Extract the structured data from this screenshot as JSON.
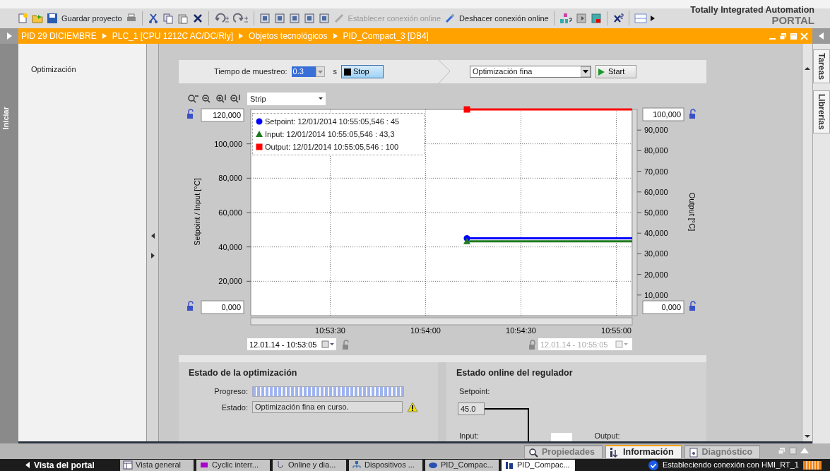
{
  "toolbar": {
    "save_label": "Guardar proyecto",
    "connect_label": "Establecer conexión online",
    "connect_disabled": true,
    "disconnect_label": "Deshacer conexión online"
  },
  "brand": {
    "line1": "Totally Integrated Automation",
    "line2": "PORTAL"
  },
  "breadcrumb": [
    "PID 29 DICIEMBRE",
    "PLC_1 [CPU 1212C AC/DC/Rly]",
    "Objetos tecnológicos",
    "PID_Compact_3 [DB4]"
  ],
  "left_side_tab": "Iniciar",
  "right_side_tabs": [
    "Tareas",
    "Librerías"
  ],
  "navigation": {
    "items": [
      "Optimización"
    ]
  },
  "measurement": {
    "sample_time_label": "Tiempo de muestreo:",
    "sample_time": "0.3",
    "unit": "s",
    "stop_button": "Stop"
  },
  "tuning": {
    "mode": "Optimización fina",
    "start_button": "Start"
  },
  "trend": {
    "view_mode": "Strip",
    "left_max": "120,000",
    "left_min": "0,000",
    "right_max": "100,000",
    "right_min": "0,000",
    "start_time": "12.01.14 - 10:53:05",
    "end_time": "12.01.14 - 10:55:05",
    "end_time_disabled": true,
    "legend": [
      {
        "kind": "circle",
        "text": ": 12/01/2014 10:55:05,546 : 45"
      },
      {
        "kind": "triangle",
        "text": ": 12/01/2014 10:55:05,546 : 43,3"
      },
      {
        "kind": "square",
        "text": ": 12/01/2014 10:55:05,546 : 100"
      }
    ],
    "chart_data": {
      "type": "line",
      "grid": true,
      "ylabel": "Setpoint / Input  [°C]",
      "y2label": "Output  [°C]",
      "xlim": [
        39185,
        39305
      ],
      "ylim": [
        0,
        120
      ],
      "y2lim": [
        0,
        100
      ],
      "x": [
        39253,
        39305
      ],
      "xticks": [
        {
          "value": 39210,
          "label": "10:53:30"
        },
        {
          "value": 39240,
          "label": "10:54:00"
        },
        {
          "value": 39270,
          "label": "10:54:30"
        },
        {
          "value": 39300,
          "label": "10:55:00"
        }
      ],
      "yticks": [
        {
          "value": 20,
          "label": "20,000"
        },
        {
          "value": 40,
          "label": "40,000"
        },
        {
          "value": 60,
          "label": "60,000"
        },
        {
          "value": 80,
          "label": "80,000"
        },
        {
          "value": 100,
          "label": "100,000"
        }
      ],
      "y2ticks": [
        {
          "value": 10,
          "label": "10,000"
        },
        {
          "value": 20,
          "label": "20,000"
        },
        {
          "value": 30,
          "label": "30,000"
        },
        {
          "value": 40,
          "label": "40,000"
        },
        {
          "value": 50,
          "label": "50,000"
        },
        {
          "value": 60,
          "label": "60,000"
        },
        {
          "value": 70,
          "label": "70,000"
        },
        {
          "value": 80,
          "label": "80,000"
        },
        {
          "value": 90,
          "label": "90,000"
        }
      ],
      "series": [
        {
          "name": "Setpoint",
          "color": "#0000ff",
          "values": [
            45,
            45
          ]
        },
        {
          "name": "Input",
          "color": "#1e7a1e",
          "values": [
            43.3,
            43.3
          ]
        },
        {
          "name": "Output",
          "color": "#ff0000",
          "axis": "y2",
          "values": [
            100,
            100
          ]
        }
      ]
    }
  },
  "optimization_status": {
    "title": "Estado de la optimización",
    "progress_label": "Progreso:",
    "level": 1.0,
    "state_label": "Estado:",
    "state": "Optimización fina en curso.",
    "warning": true
  },
  "controller_status": {
    "title": "Estado online del regulador",
    "setpoint_label": "Setpoint:",
    "setpoint": "45.0",
    "input_label": "Input:",
    "output_label": "Output:"
  },
  "inspector_tabs": [
    {
      "label": "Propiedades",
      "selected": false
    },
    {
      "label": "Información",
      "selected": true
    },
    {
      "label": "Diagnóstico",
      "selected": false
    }
  ],
  "taskbar": {
    "portal_view": "Vista del portal",
    "tabs": [
      {
        "label": "Vista general",
        "selected": false
      },
      {
        "label": "Cyclic interr...",
        "selected": false
      },
      {
        "label": "Online y dia...",
        "selected": false
      },
      {
        "label": "Dispositivos ...",
        "selected": false
      },
      {
        "label": "PID_Compac...",
        "selected": false
      },
      {
        "label": "PID_Compac...",
        "selected": true
      }
    ],
    "status": "Estableciendo conexión con HMI_RT_1"
  }
}
